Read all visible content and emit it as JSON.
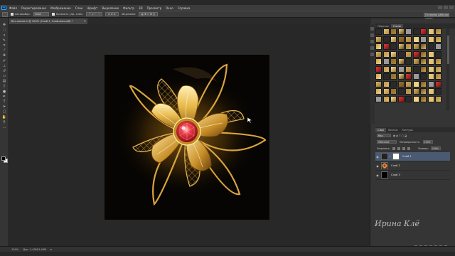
{
  "app": {
    "logo": "Ps"
  },
  "menu": [
    "Файл",
    "Редактирование",
    "Изображение",
    "Слои",
    "Шрифт",
    "Выделение",
    "Фильтр",
    "3D",
    "Просмотр",
    "Окно",
    "Справка"
  ],
  "options": {
    "autoselect_label": "Автовыбор:",
    "autoselect_value": "Слой",
    "show_controls_label": "Показать упр. элем.",
    "mode_label": "3D-режим:",
    "workspace": "Основная рабочая среда"
  },
  "document": {
    "tab_title": "без имени-1 @ 100% (Слой 1, Слой-маска/8) *",
    "close": "×"
  },
  "panels": {
    "top_tabs": [
      "Образцы",
      "Стили"
    ],
    "layers_tabs": [
      "Слои",
      "Каналы",
      "Контуры"
    ],
    "kind_label": "Вид",
    "blend_mode": "Обычные",
    "opacity_label": "Непрозрачность:",
    "opacity_value": "100%",
    "lock_label": "Закрепить:",
    "fill_label": "Заливка:",
    "fill_value": "100%"
  },
  "layers": [
    {
      "name": "Слой 1",
      "selected": true,
      "has_mask": true
    },
    {
      "name": "Слой 2",
      "selected": false,
      "has_mask": false
    },
    {
      "name": "Слой 3",
      "selected": false,
      "has_mask": false
    }
  ],
  "status": {
    "zoom": "100%",
    "doc_info": "Док: 1,49М/1,49М"
  },
  "watermark": "Ирина Клё",
  "colors": {
    "accent_gold": "#e8b84a",
    "ruby": "#d6202a",
    "selected_layer": "#4b5a73"
  }
}
